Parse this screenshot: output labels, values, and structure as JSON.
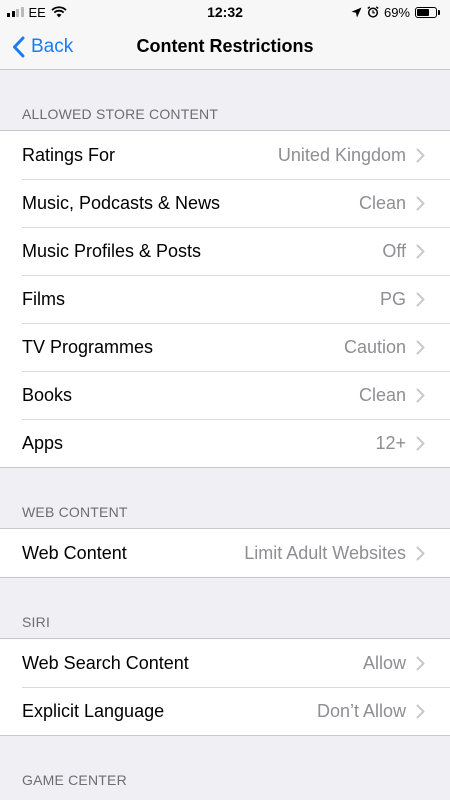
{
  "status_bar": {
    "carrier": "EE",
    "time": "12:32",
    "battery_percent": "69%",
    "battery_level": 0.69,
    "icons": [
      "signal-icon",
      "wifi-icon",
      "location-icon",
      "alarm-icon",
      "battery-icon"
    ]
  },
  "nav": {
    "back_label": "Back",
    "title": "Content Restrictions"
  },
  "sections": {
    "allowed_store": {
      "header": "ALLOWED STORE CONTENT",
      "rows": [
        {
          "label": "Ratings For",
          "value": "United Kingdom"
        },
        {
          "label": "Music, Podcasts & News",
          "value": "Clean"
        },
        {
          "label": "Music Profiles & Posts",
          "value": "Off"
        },
        {
          "label": "Films",
          "value": "PG"
        },
        {
          "label": "TV Programmes",
          "value": "Caution"
        },
        {
          "label": "Books",
          "value": "Clean"
        },
        {
          "label": "Apps",
          "value": "12+"
        }
      ]
    },
    "web": {
      "header": "WEB CONTENT",
      "rows": [
        {
          "label": "Web Content",
          "value": "Limit Adult Websites"
        }
      ]
    },
    "siri": {
      "header": "SIRI",
      "rows": [
        {
          "label": "Web Search Content",
          "value": "Allow"
        },
        {
          "label": "Explicit Language",
          "value": "Don’t Allow"
        }
      ]
    },
    "game_center": {
      "header": "GAME CENTER"
    }
  },
  "colors": {
    "accent": "#1a7cf5",
    "background": "#efeff4",
    "secondary_text": "#8e8e93"
  }
}
